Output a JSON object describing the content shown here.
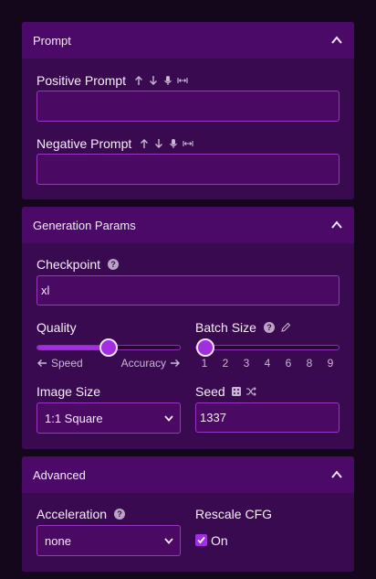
{
  "prompt_panel": {
    "title": "Prompt",
    "positive_label": "Positive Prompt",
    "positive_value": "",
    "negative_label": "Negative Prompt",
    "negative_value": ""
  },
  "generation_panel": {
    "title": "Generation Params",
    "checkpoint_label": "Checkpoint",
    "checkpoint_value": "xl",
    "quality_label": "Quality",
    "quality_value_fraction": 0.5,
    "quality_left_hint": "Speed",
    "quality_right_hint": "Accuracy",
    "batch_label": "Batch Size",
    "batch_options": [
      "1",
      "2",
      "3",
      "4",
      "6",
      "8",
      "9"
    ],
    "batch_selected": "1",
    "image_size_label": "Image Size",
    "image_size_value": "1:1 Square",
    "seed_label": "Seed",
    "seed_value": "1337"
  },
  "advanced_panel": {
    "title": "Advanced",
    "acceleration_label": "Acceleration",
    "acceleration_value": "none",
    "rescale_label": "Rescale CFG",
    "rescale_checkbox_label": "On",
    "rescale_checked": true
  },
  "colors": {
    "page_bg": "#14071b",
    "panel_bg": "#3a0a50",
    "panel_header_bg": "#4b0a68",
    "accent": "#a12fe0",
    "input_border": "#9a35c4"
  }
}
